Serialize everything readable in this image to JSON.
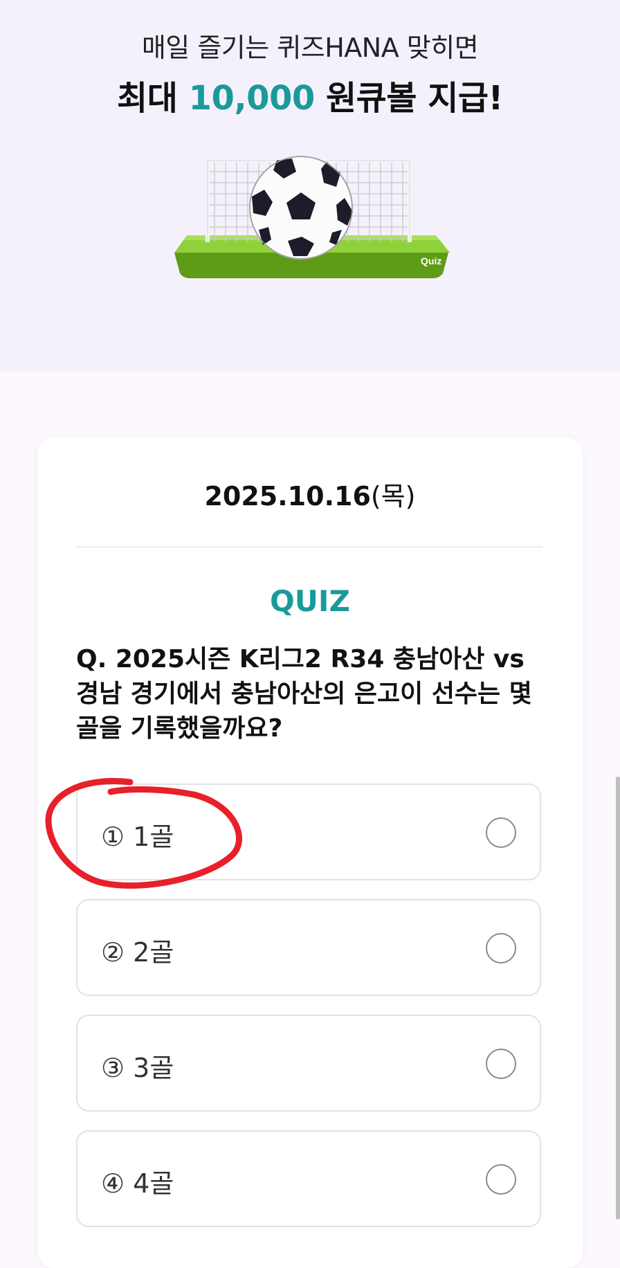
{
  "hero": {
    "line1": "매일 즐기는 퀴즈HANA 맞히면",
    "line2_prefix": "최대 ",
    "line2_amount": "10,000",
    "line2_suffix": " 원큐볼 지급!",
    "badge_text": "Quiz",
    "accent_color": "#1A9A9A"
  },
  "quiz_card": {
    "date": "2025.10.16",
    "day_of_week": "(목)",
    "label": "QUIZ",
    "question": "Q. 2025시즌 K리그2 R34 충남아산 vs 경남 경기에서 충남아산의 은고이 선수는 몇 골을 기록했을까요?",
    "options": [
      {
        "label": "① 1골",
        "selected": false
      },
      {
        "label": "② 2골",
        "selected": false
      },
      {
        "label": "③ 3골",
        "selected": false
      },
      {
        "label": "④ 4골",
        "selected": false
      }
    ]
  },
  "annotation": {
    "color": "#E8202A"
  }
}
